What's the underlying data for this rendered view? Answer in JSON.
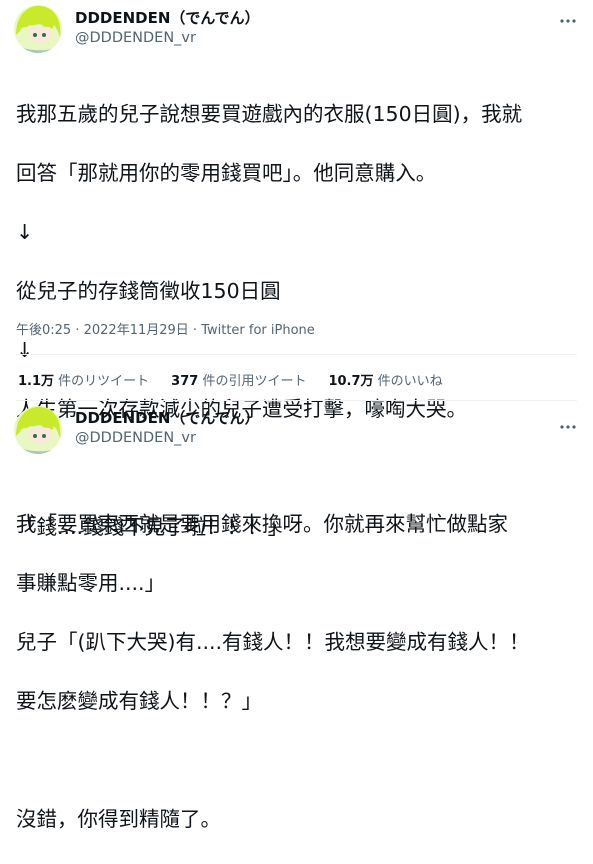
{
  "tweets": [
    {
      "display_name": "DDDENDEN（でんでん）",
      "handle": "@DDDENDEN_vr",
      "lines": [
        "我那五歲的兒子說想要買遊戲內的衣服(150日圓)，我就",
        "回答「那就用你的零用錢買吧」。他同意購入。",
        "↓",
        "從兒子的存錢筒徵收150日圓",
        "↓",
        "人生第一次存款減少的兒子遭受打擊，嚎啕大哭。",
        "",
        "「錢....錢錢不見了啦！！！」"
      ],
      "time": "午後0:25",
      "date": "2022年11月29日",
      "source": "Twitter for iPhone",
      "stats": {
        "retweets_count": "1.1万",
        "retweets_label": " 件のリツイート",
        "quotes_count": "377",
        "quotes_label": " 件の引用ツイート",
        "likes_count": "10.7万",
        "likes_label": " 件のいいね"
      }
    },
    {
      "display_name": "DDDENDEN（でんでん）",
      "handle": "@DDDENDEN_vr",
      "lines": [
        "我「要買東西就是要用錢來換呀。你就再來幫忙做點家",
        "事賺點零用....」",
        "兒子「(趴下大哭)有....有錢人！！我想要變成有錢人！！",
        "要怎麽變成有錢人！！？」",
        "",
        "沒錯，你得到精隨了。"
      ]
    }
  ],
  "separator": " · ",
  "icons": {
    "more": "more-horizontal-icon",
    "avatar": "green-haired-character-avatar"
  },
  "colors": {
    "text": "#0f1419",
    "secondary": "#536471",
    "divider": "#eff3f4"
  }
}
